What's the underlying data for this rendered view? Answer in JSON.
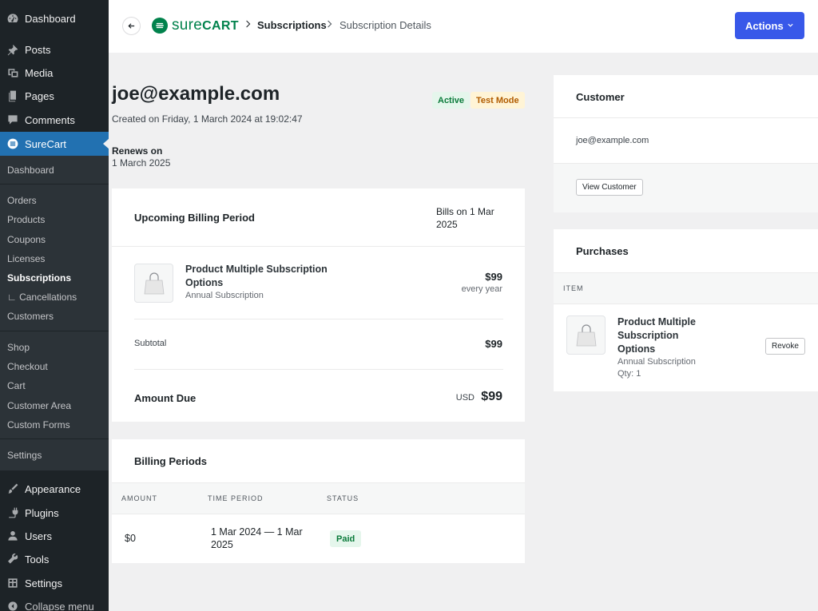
{
  "wp_menu": {
    "top_items": [
      {
        "label": "Dashboard",
        "icon": "dashboard-icon"
      },
      {
        "label": "Posts",
        "icon": "pin-icon"
      },
      {
        "label": "Media",
        "icon": "media-icon"
      },
      {
        "label": "Pages",
        "icon": "pages-icon"
      },
      {
        "label": "Comments",
        "icon": "comment-icon"
      },
      {
        "label": "SureCart",
        "icon": "surecart-icon"
      }
    ],
    "sub_items": [
      {
        "label": "Dashboard"
      },
      {
        "label": "Orders"
      },
      {
        "label": "Products"
      },
      {
        "label": "Coupons"
      },
      {
        "label": "Licenses"
      },
      {
        "label": "Subscriptions"
      },
      {
        "label": "∟ Cancellations"
      },
      {
        "label": "Customers"
      },
      {
        "label": "Shop"
      },
      {
        "label": "Checkout"
      },
      {
        "label": "Cart"
      },
      {
        "label": "Customer Area"
      },
      {
        "label": "Custom Forms"
      },
      {
        "label": "Settings"
      }
    ],
    "bottom_items": [
      {
        "label": "Appearance",
        "icon": "brush-icon"
      },
      {
        "label": "Plugins",
        "icon": "plug-icon"
      },
      {
        "label": "Users",
        "icon": "user-icon"
      },
      {
        "label": "Tools",
        "icon": "wrench-icon"
      },
      {
        "label": "Settings",
        "icon": "settings-icon"
      },
      {
        "label": "Collapse menu",
        "icon": "collapse-icon"
      }
    ]
  },
  "header": {
    "logo_light": "sure",
    "logo_bold": "CART",
    "breadcrumb": [
      "Subscriptions",
      "Subscription Details"
    ],
    "actions_label": "Actions"
  },
  "subscription": {
    "email": "joe@example.com",
    "created": "Created on Friday, 1 March 2024 at 19:02:47",
    "badges": {
      "status": "Active",
      "mode": "Test Mode"
    },
    "renews_label": "Renews on",
    "renews_value": "1 March 2025"
  },
  "upcoming": {
    "title": "Upcoming Billing Period",
    "bills_on": "Bills on 1 Mar 2025",
    "product_name": "Product Multiple Subscription Options",
    "product_sub": "Annual Subscription",
    "price": "$99",
    "interval": "every year",
    "subtotal_label": "Subtotal",
    "subtotal_value": "$99",
    "due_label": "Amount Due",
    "due_currency": "USD",
    "due_value": "$99"
  },
  "billing_periods": {
    "title": "Billing Periods",
    "columns": [
      "AMOUNT",
      "TIME PERIOD",
      "STATUS"
    ],
    "rows": [
      {
        "amount": "$0",
        "period": "1 Mar 2024 — 1 Mar 2025",
        "status": "Paid"
      }
    ]
  },
  "customer": {
    "title": "Customer",
    "email": "joe@example.com",
    "view_button": "View Customer"
  },
  "purchases": {
    "title": "Purchases",
    "column": "ITEM",
    "item_name": "Product Multiple Subscription Options",
    "item_sub": "Annual Subscription",
    "item_qty": "Qty: 1",
    "revoke_label": "Revoke"
  },
  "colors": {
    "sidebar_bg": "#1d2327",
    "submenu_bg": "#2c3338",
    "current_item": "#2271b1",
    "primary_button": "#3858e9",
    "brand_green": "#01824c",
    "active_badge_bg": "#e5f6ec",
    "test_badge_bg": "#fff4d6"
  }
}
